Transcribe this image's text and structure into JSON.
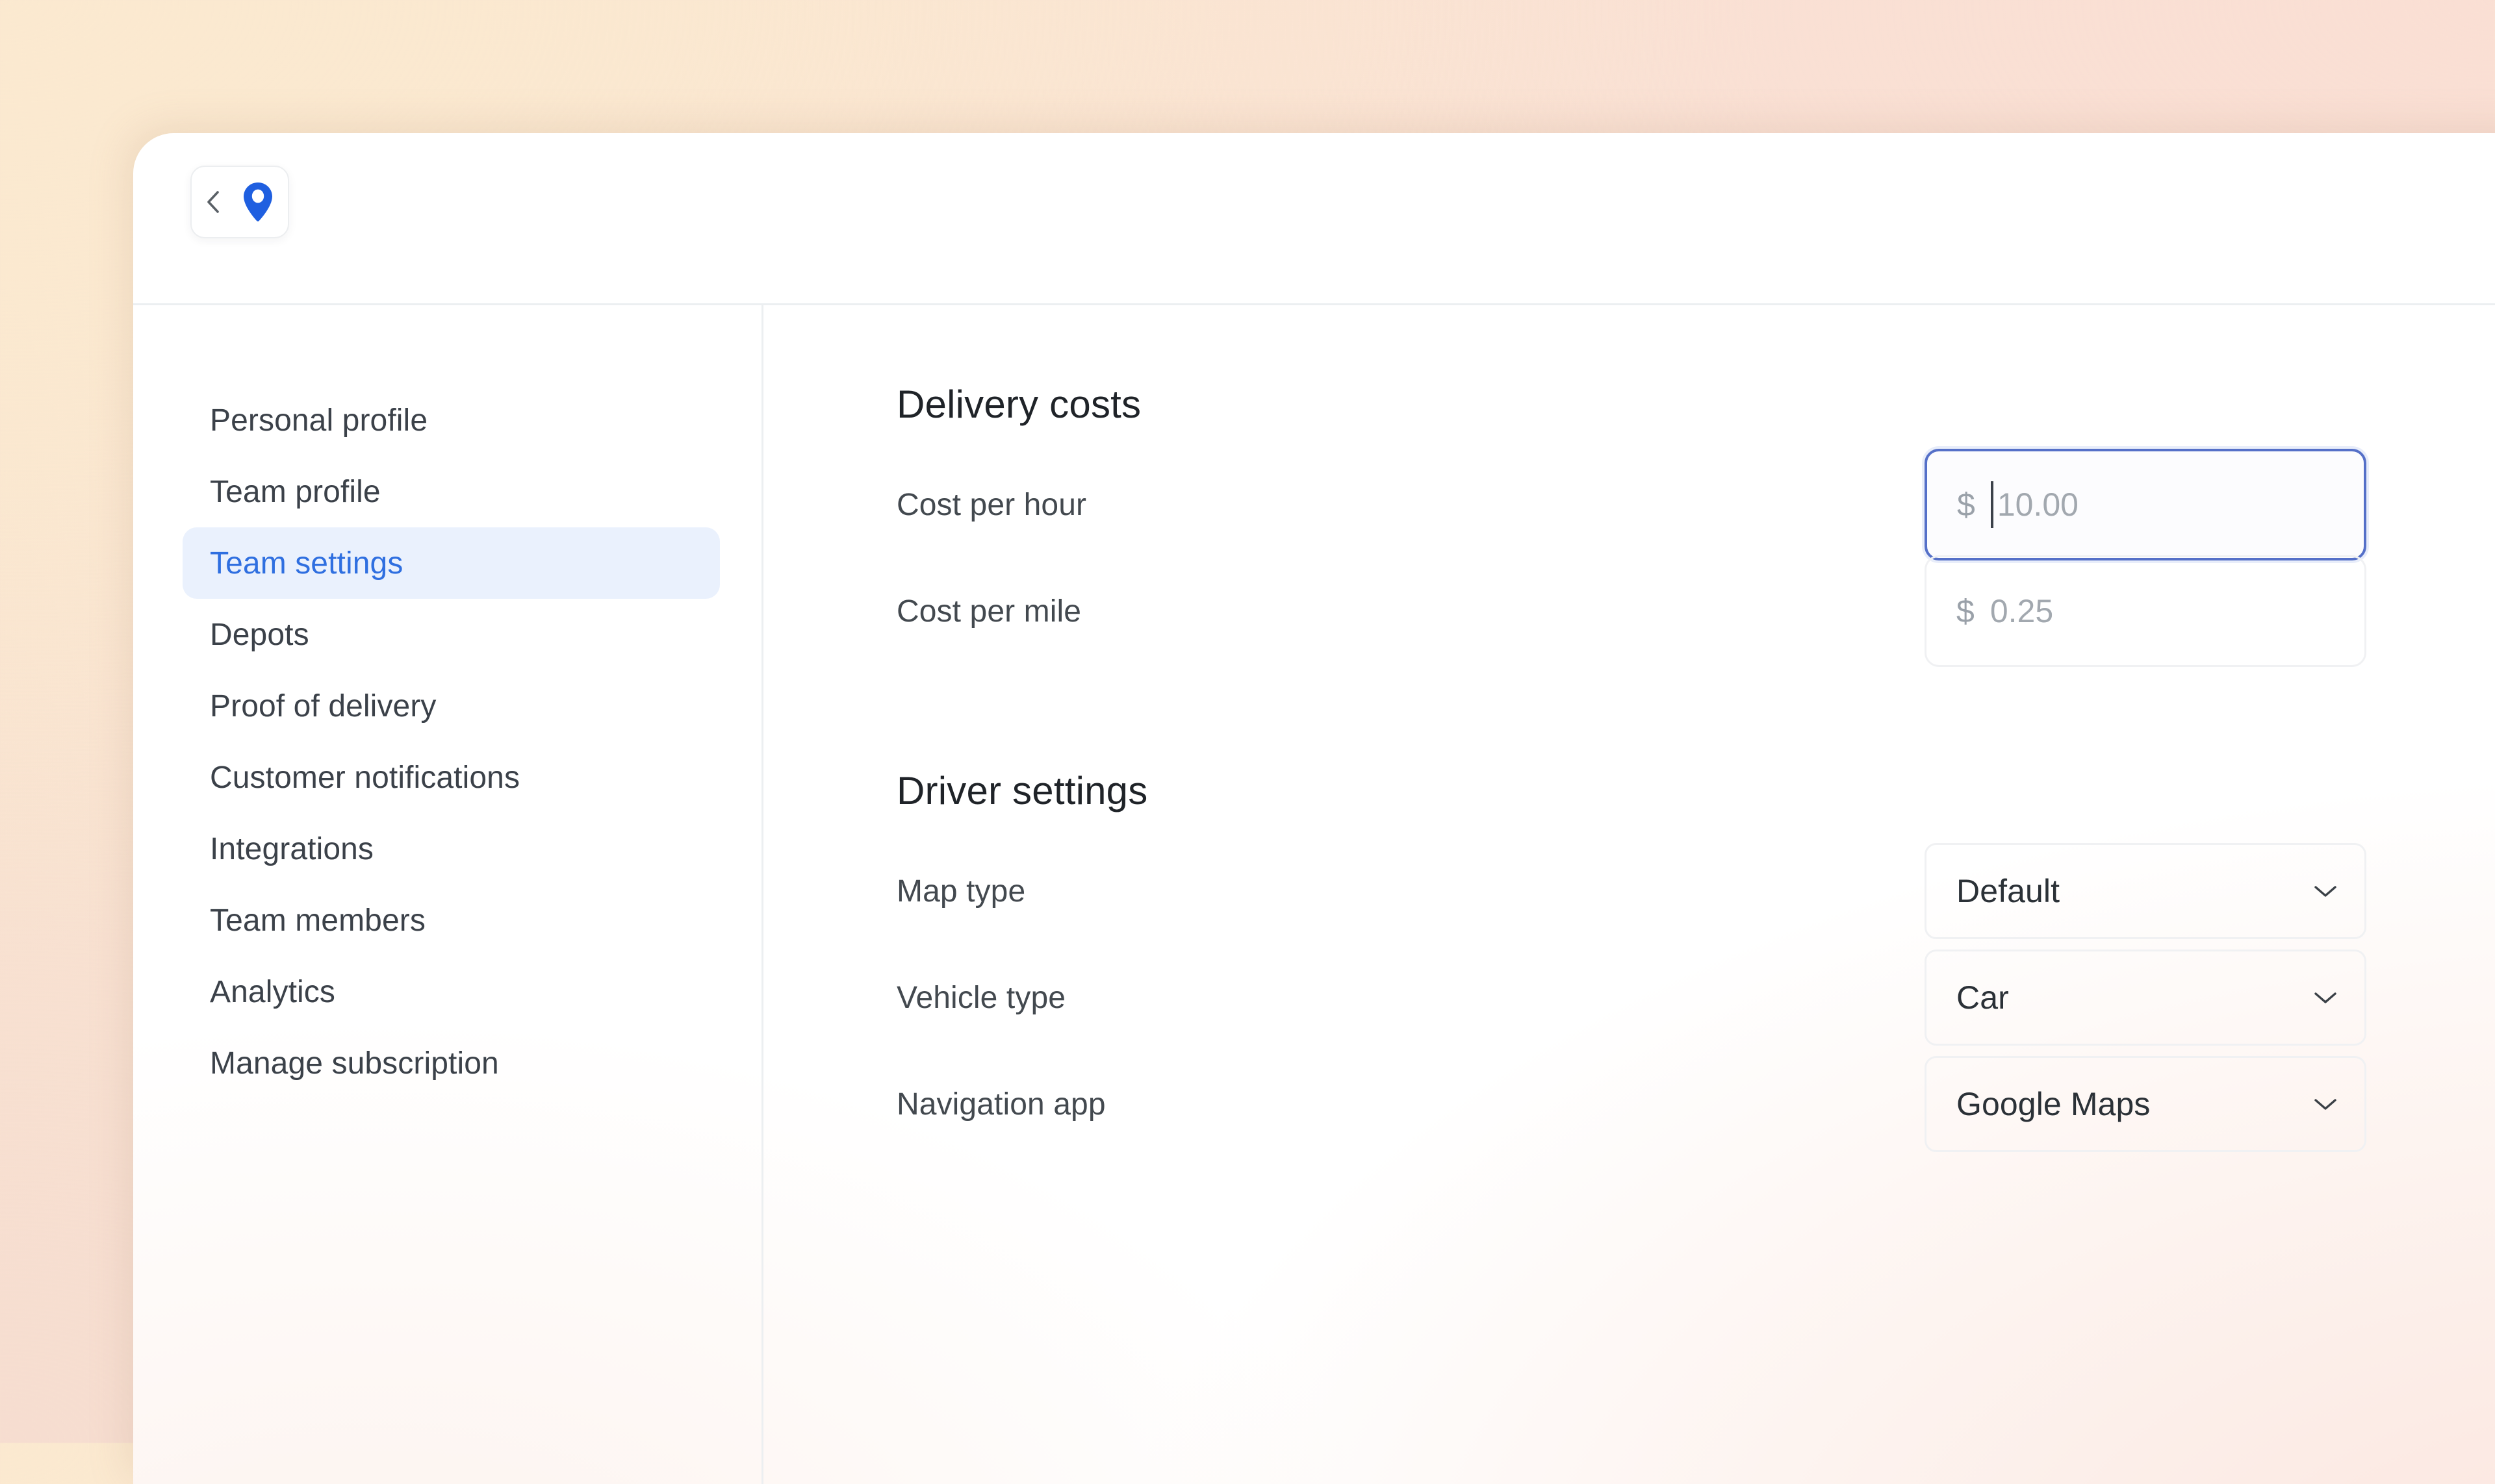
{
  "app": {
    "logo_icon": "map-pin-icon",
    "back_icon": "chevron-left-icon",
    "accent_color": "#2f6fe0",
    "pin_color": "#1f5fe0"
  },
  "sidebar": {
    "items": [
      {
        "label": "Personal profile",
        "active": false
      },
      {
        "label": "Team profile",
        "active": false
      },
      {
        "label": "Team settings",
        "active": true
      },
      {
        "label": "Depots",
        "active": false
      },
      {
        "label": "Proof of delivery",
        "active": false
      },
      {
        "label": "Customer notifications",
        "active": false
      },
      {
        "label": "Integrations",
        "active": false
      },
      {
        "label": "Team members",
        "active": false
      },
      {
        "label": "Analytics",
        "active": false
      },
      {
        "label": "Manage subscription",
        "active": false
      }
    ]
  },
  "main": {
    "sections": [
      {
        "title": "Delivery costs",
        "fields": [
          {
            "label": "Cost per hour",
            "control": "money",
            "currency": "$",
            "value": "10.00",
            "focused": true
          },
          {
            "label": "Cost per mile",
            "control": "money",
            "currency": "$",
            "value": "0.25",
            "focused": false
          }
        ]
      },
      {
        "title": "Driver settings",
        "fields": [
          {
            "label": "Map type",
            "control": "select",
            "value": "Default",
            "chevron_icon": "chevron-down-icon"
          },
          {
            "label": "Vehicle type",
            "control": "select",
            "value": "Car",
            "chevron_icon": "chevron-down-icon"
          },
          {
            "label": "Navigation app",
            "control": "select",
            "value": "Google Maps",
            "chevron_icon": "chevron-down-icon"
          }
        ]
      }
    ]
  }
}
